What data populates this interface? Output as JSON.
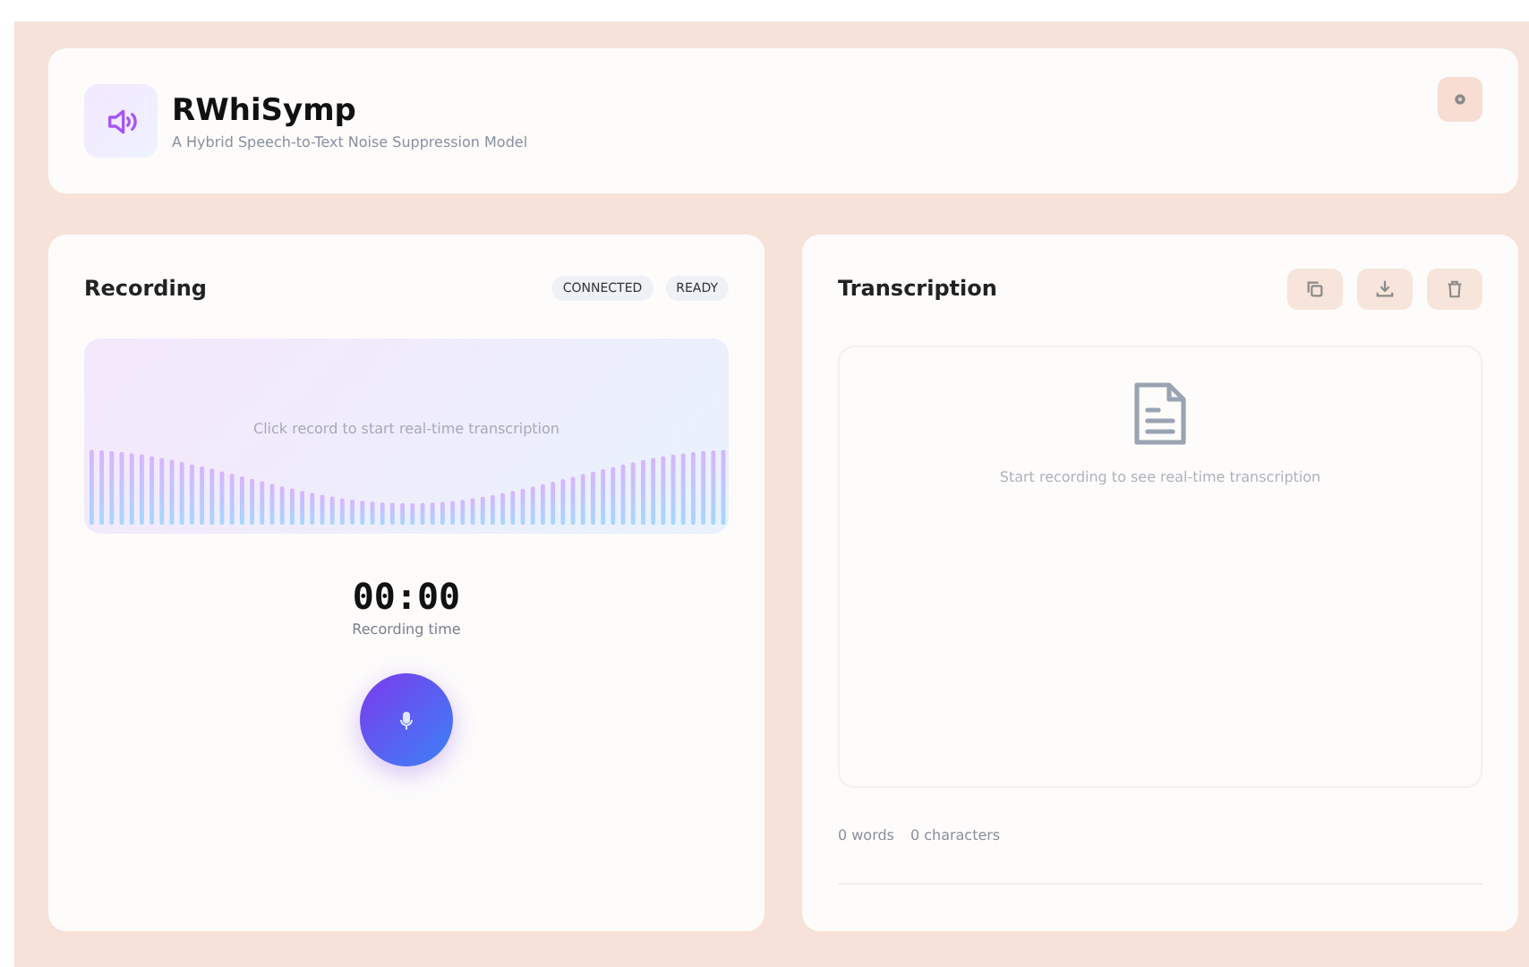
{
  "header": {
    "title": "RWhiSymp",
    "subtitle": "A Hybrid Speech-to-Text Noise Suppression Model"
  },
  "recording": {
    "title": "Recording",
    "badges": [
      "CONNECTED",
      "READY"
    ],
    "hint": "Click record to start real-time transcription",
    "timer": "00:00",
    "timer_label": "Recording time"
  },
  "transcription": {
    "title": "Transcription",
    "actions": [
      {
        "kind": "copy"
      },
      {
        "kind": "download"
      },
      {
        "kind": "clear"
      }
    ],
    "empty_text": "Start recording to see real-time transcription",
    "stats": [
      "0 words",
      "0 characters"
    ]
  }
}
